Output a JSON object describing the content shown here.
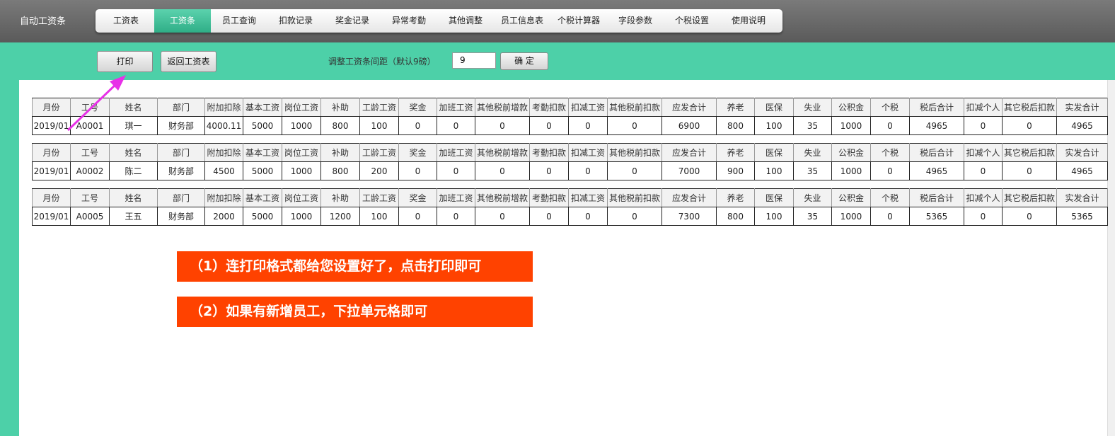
{
  "app_title": "自动工资条",
  "nav": {
    "tabs": [
      "工资表",
      "工资条",
      "员工查询",
      "扣款记录",
      "奖金记录",
      "异常考勤",
      "其他调整",
      "员工信息表",
      "个税计算器",
      "字段参数",
      "个税设置",
      "使用说明"
    ],
    "active": 1
  },
  "toolbar": {
    "print_label": "打印",
    "back_label": "返回工资表",
    "spacing_label": "调整工资条间距（默认9磅）",
    "spacing_value": "9",
    "confirm_label": "确 定"
  },
  "columns": [
    "月份",
    "工号",
    "姓名",
    "部门",
    "附加扣除",
    "基本工资",
    "岗位工资",
    "补助",
    "工龄工资",
    "奖金",
    "加班工资",
    "其他税前增款",
    "考勤扣款",
    "扣减工资",
    "其他税前扣款",
    "应发合计",
    "养老",
    "医保",
    "失业",
    "公积金",
    "个税",
    "税后合计",
    "扣减个人",
    "其它税后扣款",
    "实发合计"
  ],
  "rows": [
    [
      "2019/01",
      "A0001",
      "琪一",
      "财务部",
      "4000.11",
      "5000",
      "1000",
      "800",
      "100",
      "0",
      "0",
      "0",
      "0",
      "0",
      "0",
      "6900",
      "800",
      "100",
      "35",
      "1000",
      "0",
      "4965",
      "0",
      "0",
      "4965"
    ],
    [
      "2019/01",
      "A0002",
      "陈二",
      "财务部",
      "4500",
      "5000",
      "1000",
      "800",
      "200",
      "0",
      "0",
      "0",
      "0",
      "0",
      "0",
      "7000",
      "900",
      "100",
      "35",
      "1000",
      "0",
      "4965",
      "0",
      "0",
      "4965"
    ],
    [
      "2019/01",
      "A0005",
      "王五",
      "财务部",
      "2000",
      "5000",
      "1000",
      "1200",
      "100",
      "0",
      "0",
      "0",
      "0",
      "0",
      "0",
      "7300",
      "800",
      "100",
      "35",
      "1000",
      "0",
      "5365",
      "0",
      "0",
      "5365"
    ]
  ],
  "notes": [
    "（1）连打印格式都给您设置好了，点击打印即可",
    "（2）如果有新增员工，下拉单元格即可"
  ],
  "colors": {
    "accent": "#4dd0a8",
    "note_bg": "#ff4200",
    "arrow": "#e830e8"
  }
}
